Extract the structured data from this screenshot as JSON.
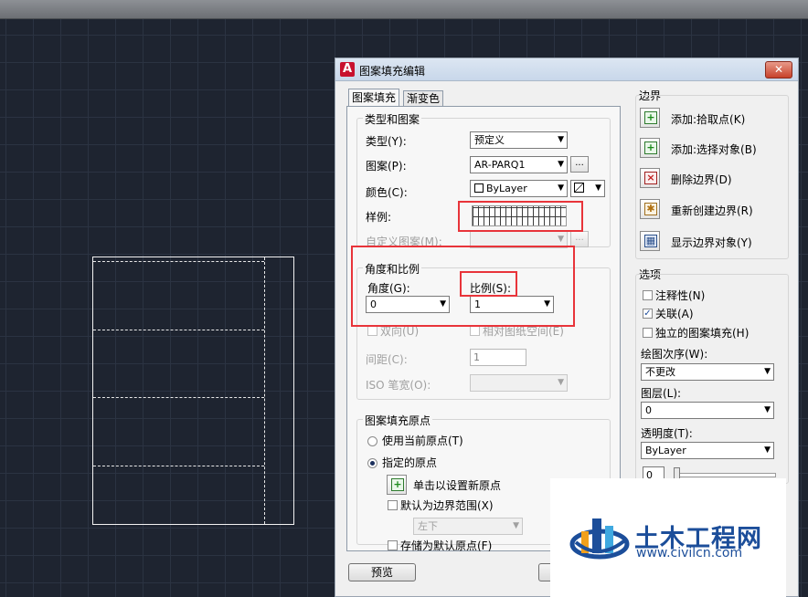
{
  "dialog": {
    "title": "图案填充编辑",
    "close_label": "✕"
  },
  "tabs": [
    {
      "label": "图案填充"
    },
    {
      "label": "渐变色"
    }
  ],
  "type_pattern": {
    "title": "类型和图案",
    "type_label": "类型(Y):",
    "type_value": "预定义",
    "pattern_label": "图案(P):",
    "pattern_value": "AR-PARQ1",
    "pattern_browse": "...",
    "color_label": "颜色(C):",
    "color_value": "ByLayer",
    "swatch_label": "样例:",
    "custom_label": "自定义图案(M):",
    "custom_browse": "..."
  },
  "angle_scale": {
    "title": "角度和比例",
    "angle_label": "角度(G):",
    "angle_value": "0",
    "scale_label": "比例(S):",
    "scale_value": "1",
    "double_label": "双向(U)",
    "relative_label": "相对图纸空间(E)",
    "spacing_label": "间距(C):",
    "spacing_value": "1",
    "iso_label": "ISO 笔宽(O):"
  },
  "origin": {
    "title": "图案填充原点",
    "use_current_label": "使用当前原点(T)",
    "specified_label": "指定的原点",
    "click_set_label": "单击以设置新原点",
    "default_extent_label": "默认为边界范围(X)",
    "extent_value": "左下",
    "store_default_label": "存储为默认原点(F)"
  },
  "boundary": {
    "title": "边界",
    "add_pick_label": "添加:拾取点(K)",
    "add_select_label": "添加:选择对象(B)",
    "remove_label": "删除边界(D)",
    "recreate_label": "重新创建边界(R)",
    "show_label": "显示边界对象(Y)"
  },
  "options": {
    "title": "选项",
    "annotative_label": "注释性(N)",
    "associative_label": "关联(A)",
    "separate_label": "独立的图案填充(H)",
    "draw_order_label": "绘图次序(W):",
    "draw_order_value": "不更改",
    "layer_label": "图层(L):",
    "layer_value": "0",
    "transparency_label": "透明度(T):",
    "transparency_value": "ByLayer",
    "transparency_amount": "0"
  },
  "footer": {
    "preview_label": "预览"
  },
  "watermark": {
    "name": "土木工程网",
    "url": "www.civilcn.com"
  },
  "colors": {
    "highlight": "#e8343a",
    "canvas": "#1e2430",
    "watermark": "#1c4e9a"
  }
}
